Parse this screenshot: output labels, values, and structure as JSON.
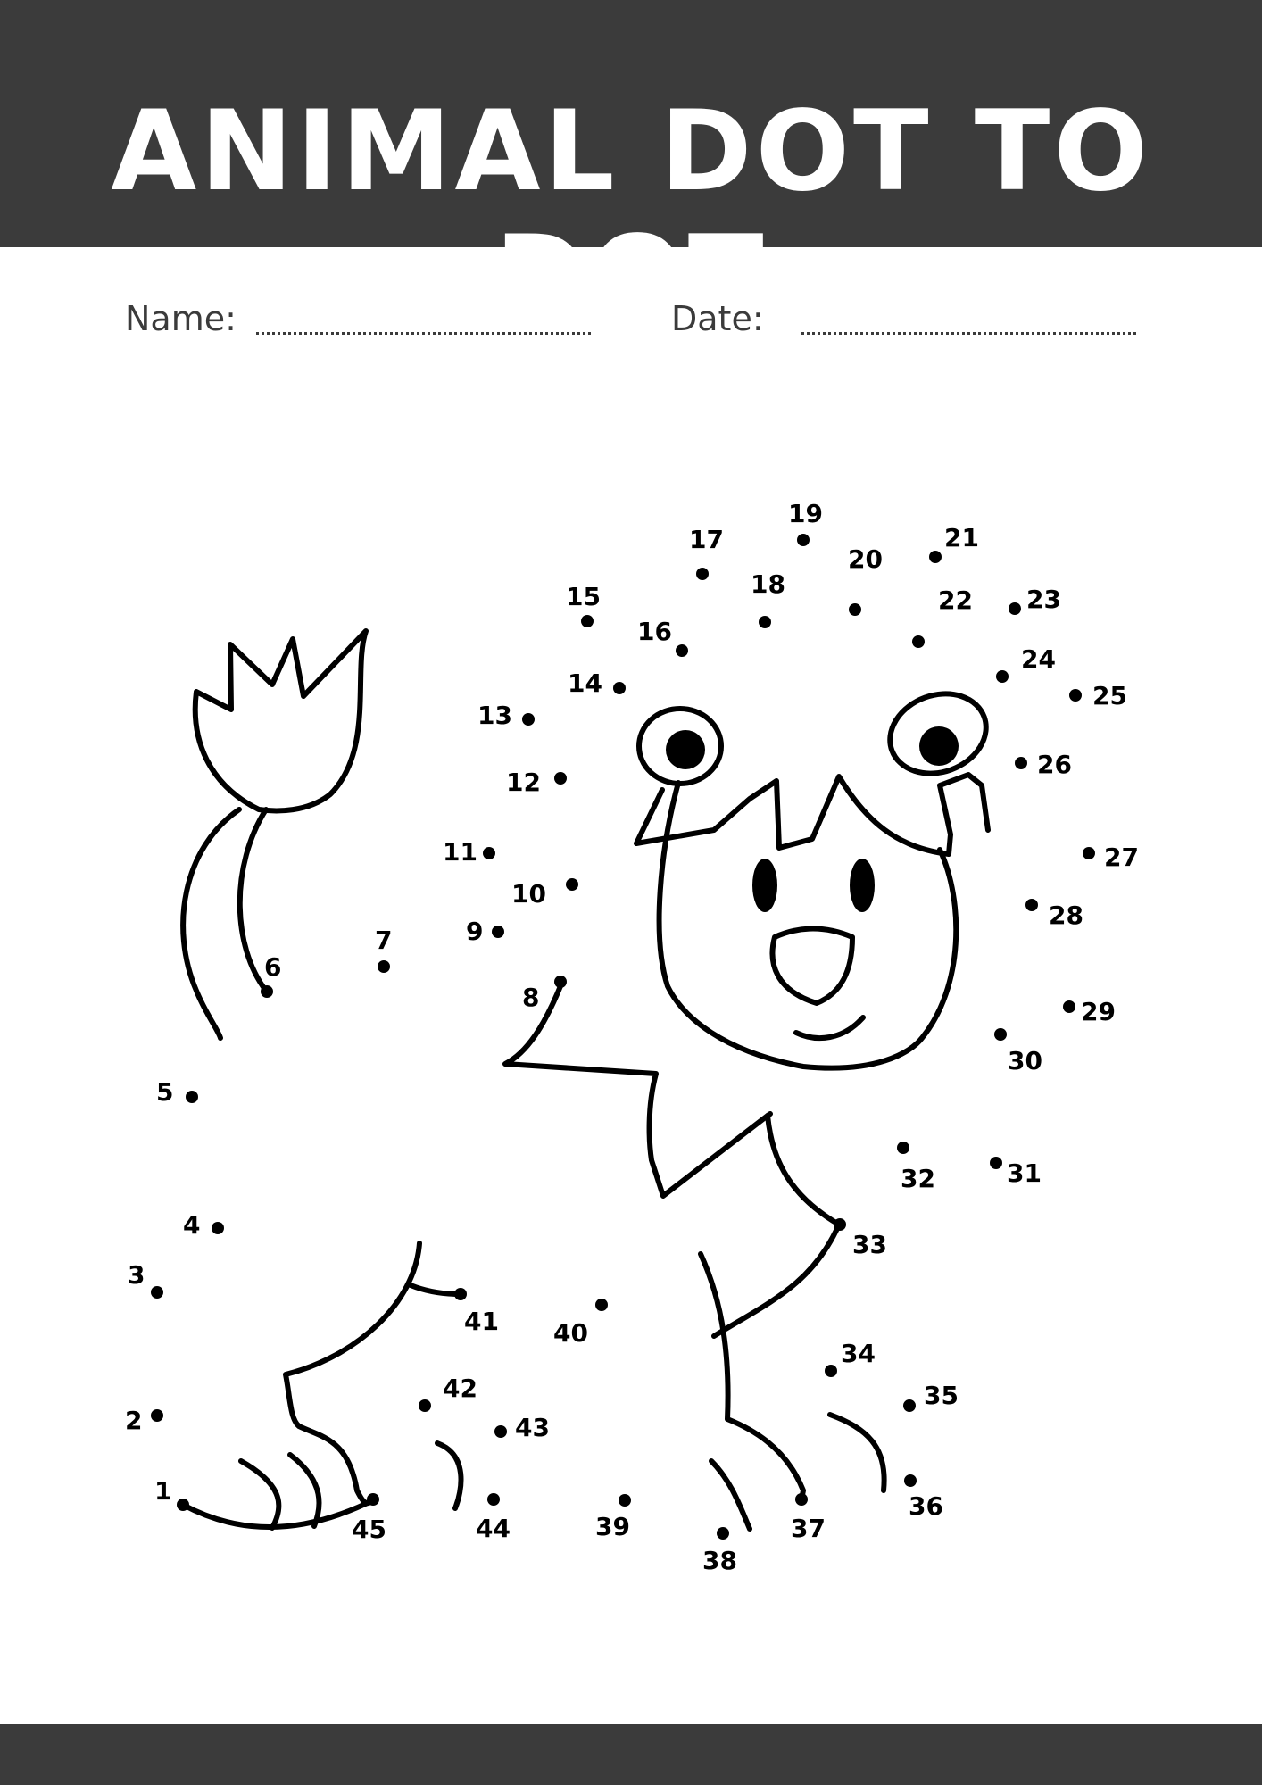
{
  "worksheet": {
    "title": "ANIMAL DOT TO DOT",
    "name_label": "Name:",
    "date_label": "Date:"
  },
  "dots": [
    {
      "n": "1"
    },
    {
      "n": "2"
    },
    {
      "n": "3"
    },
    {
      "n": "4"
    },
    {
      "n": "5"
    },
    {
      "n": "6"
    },
    {
      "n": "7"
    },
    {
      "n": "8"
    },
    {
      "n": "9"
    },
    {
      "n": "10"
    },
    {
      "n": "11"
    },
    {
      "n": "12"
    },
    {
      "n": "13"
    },
    {
      "n": "14"
    },
    {
      "n": "15"
    },
    {
      "n": "16"
    },
    {
      "n": "17"
    },
    {
      "n": "18"
    },
    {
      "n": "19"
    },
    {
      "n": "20"
    },
    {
      "n": "21"
    },
    {
      "n": "22"
    },
    {
      "n": "23"
    },
    {
      "n": "24"
    },
    {
      "n": "25"
    },
    {
      "n": "26"
    },
    {
      "n": "27"
    },
    {
      "n": "28"
    },
    {
      "n": "29"
    },
    {
      "n": "30"
    },
    {
      "n": "31"
    },
    {
      "n": "32"
    },
    {
      "n": "33"
    },
    {
      "n": "34"
    },
    {
      "n": "35"
    },
    {
      "n": "36"
    },
    {
      "n": "37"
    },
    {
      "n": "38"
    },
    {
      "n": "39"
    },
    {
      "n": "40"
    },
    {
      "n": "41"
    },
    {
      "n": "42"
    },
    {
      "n": "43"
    },
    {
      "n": "44"
    },
    {
      "n": "45"
    }
  ],
  "colors": {
    "bar": "#3b3b3b",
    "ink": "#000000"
  }
}
